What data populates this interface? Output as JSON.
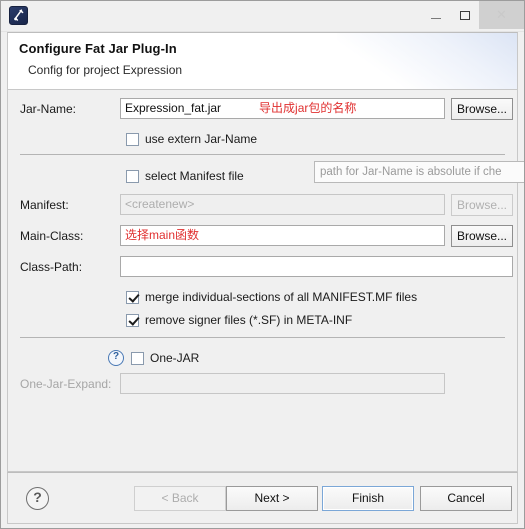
{
  "window": {
    "app_icon_name": "fat-jar-app-icon",
    "controls": {
      "minimize": "—",
      "maximize": "□",
      "close": "✕"
    }
  },
  "header": {
    "title": "Configure Fat Jar Plug-In",
    "subtitle": "Config for project Expression"
  },
  "form": {
    "jar_name": {
      "label": "Jar-Name:",
      "value": "Expression_fat.jar",
      "annotation": "导出成jar包的名称",
      "browse_label": "Browse..."
    },
    "use_extern": {
      "label": "use extern Jar-Name",
      "checked": false
    },
    "select_manifest": {
      "label": "select Manifest file",
      "checked": false
    },
    "manifest": {
      "label": "Manifest:",
      "value": "<createnew>",
      "browse_label": "Browse..."
    },
    "main_class": {
      "label": "Main-Class:",
      "annotation": "选择main函数",
      "browse_label": "Browse..."
    },
    "class_path": {
      "label": "Class-Path:",
      "value": ""
    },
    "merge_sections": {
      "label": "merge individual-sections of all MANIFEST.MF files",
      "checked": true
    },
    "remove_signer": {
      "label": "remove signer files (*.SF) in META-INF",
      "checked": true
    },
    "one_jar": {
      "label": "One-JAR",
      "checked": false,
      "help_glyph": "?"
    },
    "one_jar_expand": {
      "label": "One-Jar-Expand:",
      "value": ""
    }
  },
  "tooltip": {
    "text": "path for Jar-Name is absolute if che"
  },
  "buttonbar": {
    "help_glyph": "?",
    "back": "< Back",
    "next": "Next >",
    "finish": "Finish",
    "cancel": "Cancel"
  },
  "colors": {
    "annotation_red": "#e03030",
    "focus_blue": "#7ba7d7",
    "dialog_bg": "#f0f0f0"
  }
}
